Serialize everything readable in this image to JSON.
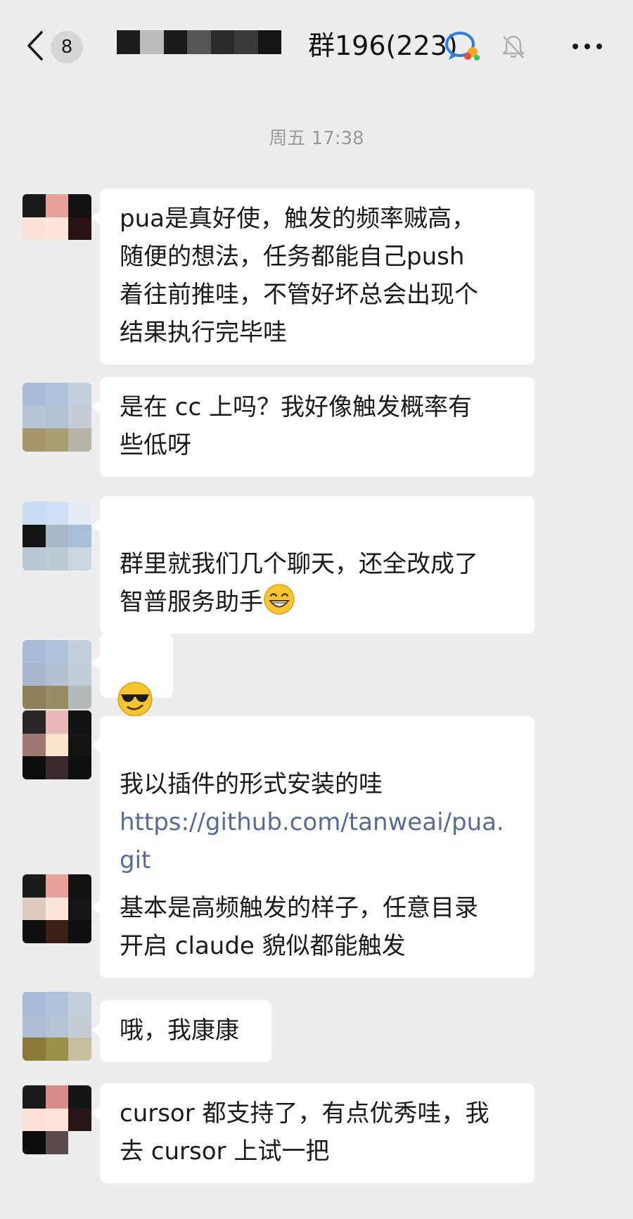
{
  "header": {
    "unread_count": "8",
    "title": "群196(223)",
    "icons": {
      "back": "chevron-left-icon",
      "group": "group-chat-icon",
      "mute": "bell-off-icon",
      "more": "more-dots-icon"
    }
  },
  "timestamp": "周五 17:38",
  "messages": [
    {
      "text": "pua是真好使，触发的频率贼高，\n随便的想法，任务都能自己push\n着往前推哇，不管好坏总会出现个\n结果执行完毕哇"
    },
    {
      "text": "是在 cc 上吗？我好像触发概率有\n些低呀"
    },
    {
      "text": "群里就我们几个聊天，还全改成了\n智普服务助手",
      "emoji": "grinning-face"
    },
    {
      "emoji": "smiling-face-with-sunglasses"
    },
    {
      "text": "我以插件的形式安装的哇",
      "link": "https://github.com/tanweai/pua.git"
    },
    {
      "text": "基本是高频触发的样子，任意目录\n开启 claude 貌似都能触发"
    },
    {
      "text": "哦，我康康"
    },
    {
      "text": "cursor 都支持了，有点优秀哇，我\n去 cursor 上试一把"
    }
  ],
  "colors": {
    "background": "#ededed",
    "bubble": "#ffffff",
    "link": "#576b95",
    "muted": "#9a9a9a"
  }
}
